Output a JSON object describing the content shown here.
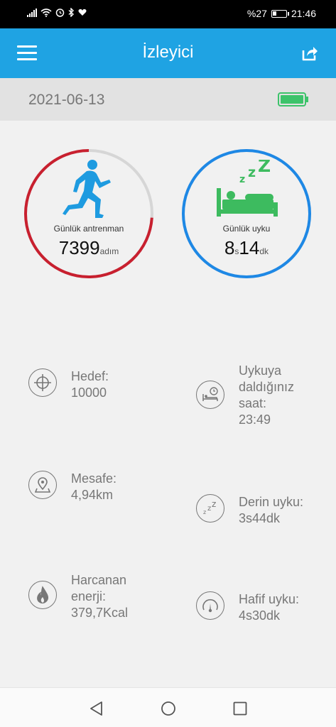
{
  "status_bar": {
    "icons_left": [
      "signal-icon",
      "wifi-icon",
      "alarm-icon",
      "bluetooth-icon",
      "heart-icon"
    ],
    "battery_percent": "%27",
    "battery_level": 0.27,
    "time": "21:46"
  },
  "app_bar": {
    "title": "İzleyici",
    "menu_icon": "hamburger-menu-icon",
    "share_icon": "share-icon"
  },
  "date_bar": {
    "date": "2021-06-13",
    "device_battery_icon": "battery-full-icon",
    "device_battery_color": "#3cc36a"
  },
  "rings": {
    "activity": {
      "label": "Günlük antrenman",
      "value": "7399",
      "unit": "adım",
      "progress": 0.74,
      "color": "#c8202f",
      "track_color": "#d6d6d6",
      "icon": "runner-icon",
      "icon_color": "#1e9be0"
    },
    "sleep": {
      "label": "Günlük uyku",
      "hours": "8",
      "hours_unit": "s",
      "minutes": "14",
      "minutes_unit": "dk",
      "progress": 1.0,
      "color": "#1e88e5",
      "icon": "sleeping-bed-icon",
      "icon_color": "#3dbb5f"
    }
  },
  "stats_left": [
    {
      "icon": "target-icon",
      "lines": [
        "Hedef:",
        "10000"
      ]
    },
    {
      "icon": "location-pin-icon",
      "lines": [
        "Mesafe:",
        "4,94km"
      ]
    },
    {
      "icon": "flame-icon",
      "lines": [
        "Harcanan",
        "enerji:",
        "379,7Kcal"
      ]
    }
  ],
  "stats_right": [
    {
      "icon": "bed-clock-icon",
      "lines": [
        "Uykuya",
        "daldığınız",
        "saat:",
        "23:49"
      ]
    },
    {
      "icon": "deep-sleep-icon",
      "lines": [
        "Derin uyku:",
        "3s44dk"
      ]
    },
    {
      "icon": "light-sleep-icon",
      "lines": [
        "Hafif uyku:",
        "4s30dk"
      ]
    }
  ],
  "nav_bar": {
    "buttons": [
      "back-icon",
      "home-icon",
      "recents-icon"
    ]
  }
}
